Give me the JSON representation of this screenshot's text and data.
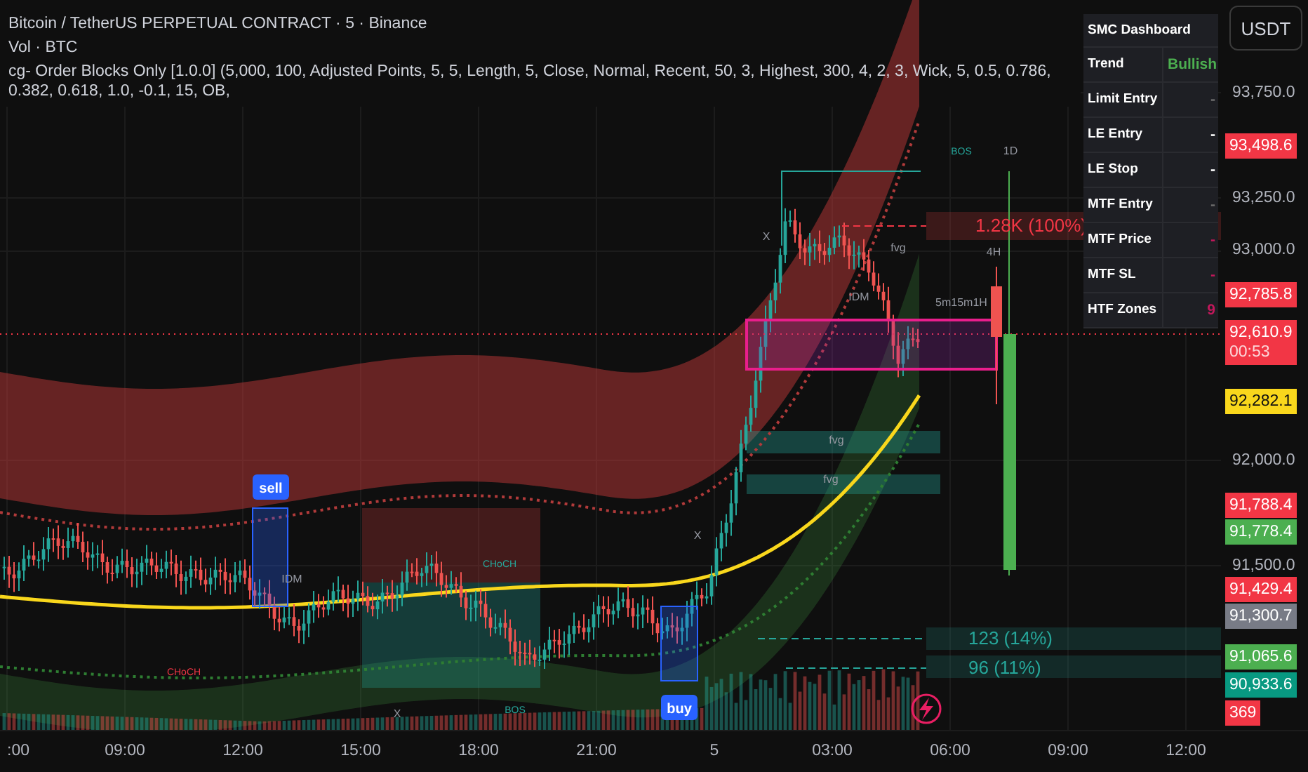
{
  "legend": {
    "title": "Bitcoin / TetherUS PERPETUAL CONTRACT · 5 · Binance",
    "volume": "Vol · BTC",
    "indicator": "cg- Order Blocks Only [1.0.0] (5,000, 100, Adjusted Points, 5, 5, Length, 5, Close, Normal, Recent, 50, 3, Highest, 300, 4, 2, 3, Wick, 5, 0.5, 0.786, 0.382, 0.618, 1.0, -0.1, 15, OB,"
  },
  "dashboard": {
    "title": "SMC Dashboard",
    "rows": [
      {
        "label": "Trend",
        "value": "Bullish",
        "color": "#4caf50"
      },
      {
        "label": "Limit Entry",
        "value": "-",
        "color": "#6b6b6b"
      },
      {
        "label": "LE Entry",
        "value": "-",
        "color": "#ffffff"
      },
      {
        "label": "LE Stop",
        "value": "-",
        "color": "#ffffff"
      },
      {
        "label": "MTF Entry",
        "value": "-",
        "color": "#6b6b6b"
      },
      {
        "label": "MTF Price",
        "value": "-",
        "color": "#c2185b"
      },
      {
        "label": "MTF SL",
        "value": "-",
        "color": "#c2185b"
      },
      {
        "label": "HTF Zones",
        "value": "9",
        "color": "#c2185b"
      }
    ]
  },
  "currency_button": "USDT",
  "price_scale": [
    "93,750.0",
    "93,250.0",
    "93,000.0",
    "92,000.0",
    "91,500.0"
  ],
  "price_tags": [
    {
      "kind": "price",
      "label": "93,498.6",
      "color": "#f23645"
    },
    {
      "kind": "price",
      "label": "92,785.8",
      "color": "#f23645"
    },
    {
      "kind": "price",
      "label": "92,610.9",
      "sub": "00:53",
      "color": "#f23645"
    },
    {
      "kind": "price",
      "label": "92,282.1",
      "color": "#f9d71c"
    },
    {
      "kind": "price",
      "label": "91,788.4",
      "color": "#f23645"
    },
    {
      "kind": "price",
      "label": "91,778.4",
      "color": "#4caf50"
    },
    {
      "kind": "price",
      "label": "91,429.4",
      "color": "#f23645"
    },
    {
      "kind": "price",
      "label": "91,300.7",
      "color": "#787b86"
    },
    {
      "kind": "price",
      "label": "91,065.6",
      "color": "#4caf50"
    },
    {
      "kind": "price",
      "label": "90,933.6",
      "color": "#089981"
    },
    {
      "kind": "volume",
      "label": "369",
      "color": "#f23645"
    }
  ],
  "time_axis": [
    ":00",
    "09:00",
    "12:00",
    "15:00",
    "18:00",
    "21:00",
    "5",
    "03:00",
    "06:00",
    "09:00",
    "12:00"
  ],
  "chart_labels": [
    {
      "kind": "signal",
      "text": "sell"
    },
    {
      "kind": "signal",
      "text": "buy"
    },
    {
      "kind": "level_loss",
      "text": "1.28K (100%)"
    },
    {
      "kind": "level_gain",
      "text": "123 (14%)"
    },
    {
      "kind": "level_gain",
      "text": "96 (11%)"
    },
    {
      "kind": "marker",
      "text": "fvg"
    },
    {
      "kind": "marker",
      "text": "fvg"
    },
    {
      "kind": "marker",
      "text": "fvg"
    },
    {
      "kind": "structure",
      "text": "BOS"
    },
    {
      "kind": "marker",
      "text": "1D"
    },
    {
      "kind": "marker",
      "text": "4H"
    },
    {
      "kind": "marker",
      "text": "5m15m1H"
    },
    {
      "kind": "marker",
      "text": "X"
    },
    {
      "kind": "marker",
      "text": "X"
    },
    {
      "kind": "marker",
      "text": "X"
    },
    {
      "kind": "marker",
      "text": "IDM"
    },
    {
      "kind": "marker",
      "text": "IDM"
    },
    {
      "kind": "structure",
      "text": "CHoCH"
    },
    {
      "kind": "structure_red",
      "text": "CHoCH"
    },
    {
      "kind": "structure",
      "text": "BOS"
    }
  ]
}
